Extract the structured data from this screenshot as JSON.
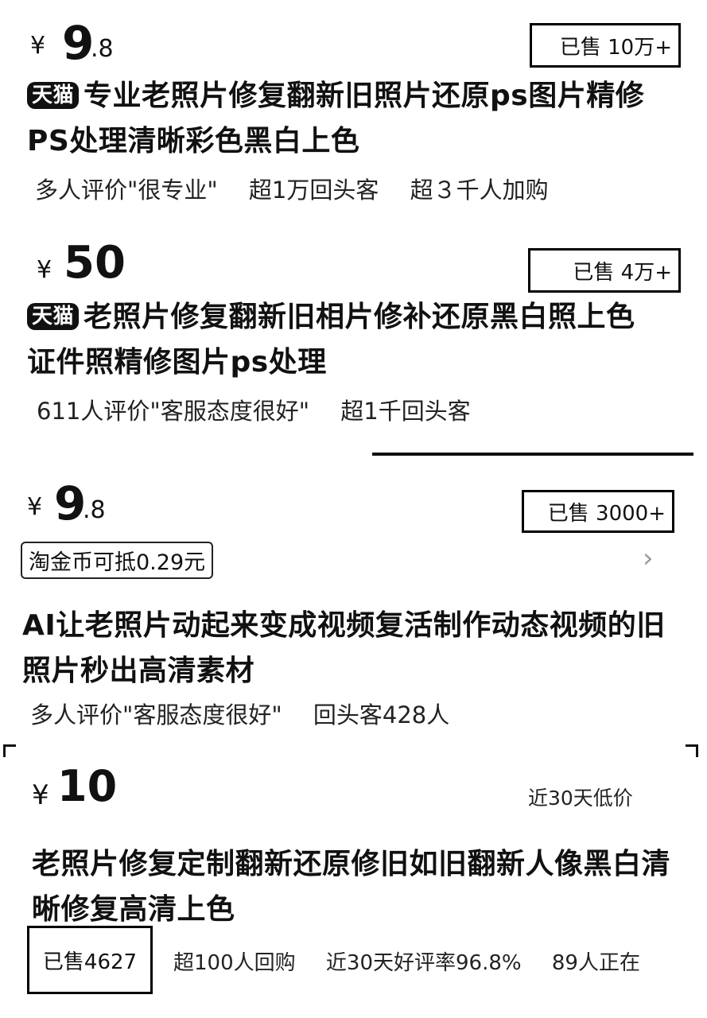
{
  "items": [
    {
      "currency": "¥",
      "price_int": "9",
      "price_dec": ".8",
      "sold": "已售 10万+",
      "badge": "天猫",
      "title": "专业老照片修复翻新旧照片还原ps图片精修PS处理清晰彩色黑白上色",
      "tags": [
        "多人评价\"很专业\"",
        "超1万回头客",
        "超３千人加购"
      ]
    },
    {
      "currency": "¥",
      "price_int": "50",
      "price_dec": "",
      "sold": "已售 4万+",
      "badge": "天猫",
      "title": "老照片修复翻新旧相片修补还原黑白照上色证件照精修图片ps处理",
      "tags": [
        "611人评价\"客服态度很好\"",
        "超1千回头客"
      ]
    },
    {
      "currency": "¥",
      "price_int": "9",
      "price_dec": ".8",
      "sold": "已售 3000+",
      "coin": "淘金币可抵0.29元",
      "title": "AI让老照片动起来变成视频复活制作动态视频的旧照片秒出高清素材",
      "tags": [
        "多人评价\"客服态度很好\"",
        "回头客428人"
      ]
    },
    {
      "currency": "¥",
      "price_int": "10",
      "price_dec": "",
      "price_note": "近30天低价",
      "title": "老照片修复定制翻新还原修旧如旧翻新人像黑白清晰修复高清上色",
      "sold": "已售4627",
      "tags": [
        "超100人回购",
        "近30天好评率96.8%",
        "89人正在"
      ]
    }
  ],
  "icons": {
    "chevron": "chevron-right-icon"
  }
}
